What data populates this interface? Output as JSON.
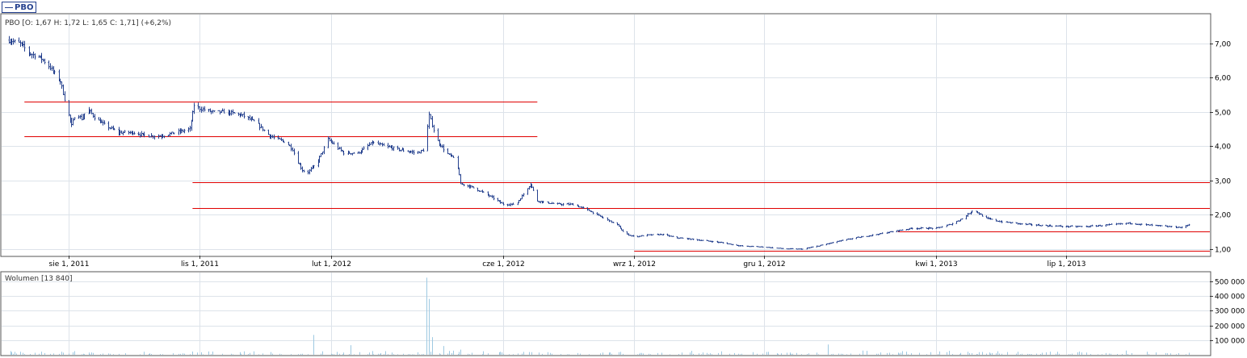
{
  "legend": {
    "label": "PBO",
    "color": "#24408e"
  },
  "price_info": "PBO [O: 1,67  H: 1,72  L: 1,65  C: 1,71] (+6,2%)",
  "volume_info": "Wolumen [13 840]",
  "colors": {
    "price": "#24408e",
    "volume": "#9ec9e2",
    "levels": "#e00000",
    "grid": "#dde3ea",
    "frame": "#555555"
  },
  "chart_data": [
    {
      "type": "line",
      "title": "PBO",
      "x_ticks": [
        "sie 1, 2011",
        "lis 1, 2011",
        "lut 1, 2012",
        "cze 1, 2012",
        "wrz 1, 2012",
        "gru 1, 2012",
        "kwi 1, 2013",
        "lip 1, 2013"
      ],
      "y_ticks": [
        "1,00",
        "2,00",
        "3,00",
        "4,00",
        "5,00",
        "6,00",
        "7,00"
      ],
      "ylim": [
        0.8,
        7.85
      ],
      "xlim": [
        "2011-06-15",
        "2013-10-10"
      ],
      "series": [
        {
          "name": "PBO",
          "x": [
            "2011-06-20",
            "2011-06-28",
            "2011-07-05",
            "2011-07-12",
            "2011-07-19",
            "2011-07-26",
            "2011-07-30",
            "2011-08-03",
            "2011-08-06",
            "2011-08-10",
            "2011-08-14",
            "2011-08-20",
            "2011-08-27",
            "2011-09-05",
            "2011-09-15",
            "2011-09-25",
            "2011-10-05",
            "2011-10-15",
            "2011-10-25",
            "2011-10-28",
            "2011-11-01",
            "2011-11-10",
            "2011-11-20",
            "2011-12-01",
            "2011-12-10",
            "2011-12-20",
            "2012-01-01",
            "2012-01-05",
            "2012-01-08",
            "2012-01-12",
            "2012-01-15",
            "2012-01-22",
            "2012-01-30",
            "2012-02-10",
            "2012-02-20",
            "2012-03-01",
            "2012-03-10",
            "2012-03-20",
            "2012-04-01",
            "2012-04-07",
            "2012-04-10",
            "2012-04-15",
            "2012-04-22",
            "2012-04-29",
            "2012-05-02",
            "2012-05-10",
            "2012-05-20",
            "2012-06-01",
            "2012-06-10",
            "2012-06-15",
            "2012-06-20",
            "2012-06-25",
            "2012-07-01",
            "2012-07-10",
            "2012-07-20",
            "2012-08-01",
            "2012-08-10",
            "2012-08-20",
            "2012-08-25",
            "2012-09-01",
            "2012-09-10",
            "2012-09-20",
            "2012-10-01",
            "2012-10-15",
            "2012-11-01",
            "2012-11-15",
            "2012-12-01",
            "2012-12-15",
            "2012-12-28",
            "2013-01-10",
            "2013-01-20",
            "2013-02-01",
            "2013-02-15",
            "2013-03-01",
            "2013-03-15",
            "2013-04-01",
            "2013-04-10",
            "2013-04-20",
            "2013-04-27",
            "2013-05-05",
            "2013-05-15",
            "2013-06-01",
            "2013-06-15",
            "2013-07-01",
            "2013-07-15",
            "2013-08-01",
            "2013-08-15",
            "2013-08-25",
            "2013-09-01",
            "2013-09-10",
            "2013-09-20",
            "2013-09-25"
          ],
          "y": [
            7.1,
            7.0,
            6.7,
            6.6,
            6.3,
            5.9,
            5.2,
            4.6,
            5.0,
            4.8,
            5.1,
            4.8,
            4.6,
            4.4,
            4.4,
            4.3,
            4.3,
            4.4,
            4.5,
            5.2,
            5.1,
            5.0,
            5.0,
            4.9,
            4.7,
            4.3,
            4.1,
            3.9,
            3.6,
            3.3,
            3.2,
            3.5,
            4.2,
            3.8,
            3.8,
            4.1,
            4.0,
            3.9,
            3.8,
            3.9,
            4.9,
            4.2,
            3.8,
            3.6,
            2.9,
            2.8,
            2.6,
            2.3,
            2.3,
            2.6,
            2.9,
            2.4,
            2.35,
            2.3,
            2.3,
            2.1,
            1.9,
            1.7,
            1.45,
            1.35,
            1.4,
            1.42,
            1.32,
            1.26,
            1.18,
            1.08,
            1.05,
            1.0,
            0.99,
            1.1,
            1.2,
            1.3,
            1.4,
            1.5,
            1.6,
            1.6,
            1.7,
            1.9,
            2.15,
            1.9,
            1.8,
            1.72,
            1.68,
            1.65,
            1.65,
            1.7,
            1.75,
            1.7,
            1.68,
            1.65,
            1.62,
            1.71
          ]
        }
      ],
      "levels": [
        {
          "y": 5.3,
          "x_start": "2011-07-01",
          "x_end": "2012-06-25"
        },
        {
          "y": 4.3,
          "x_start": "2011-07-01",
          "x_end": "2012-06-25"
        },
        {
          "y": 2.95,
          "x_start": "2011-10-27",
          "x_end": "2013-10-10"
        },
        {
          "y": 2.2,
          "x_start": "2011-10-27",
          "x_end": "2013-10-10"
        },
        {
          "y": 1.5,
          "x_start": "2013-03-05",
          "x_end": "2013-10-10"
        },
        {
          "y": 0.95,
          "x_start": "2012-09-01",
          "x_end": "2013-10-10"
        }
      ]
    },
    {
      "type": "bar",
      "title": "Wolumen",
      "y_ticks": [
        "100 000",
        "200 000",
        "300 000",
        "400 000",
        "500 000"
      ],
      "ylim": [
        0,
        560000
      ],
      "x": [
        "2011-06-25",
        "2011-08-05",
        "2011-09-10",
        "2011-10-30",
        "2011-12-15",
        "2012-01-20",
        "2012-02-05",
        "2012-02-15",
        "2012-03-10",
        "2012-04-08",
        "2012-04-10",
        "2012-04-12",
        "2012-04-20",
        "2012-05-02",
        "2012-06-15",
        "2012-08-10",
        "2012-09-20",
        "2012-11-10",
        "2012-12-10",
        "2013-01-15",
        "2013-03-20",
        "2013-05-01",
        "2013-07-10",
        "2013-09-10",
        "2013-09-25"
      ],
      "values": [
        8000,
        12000,
        10000,
        15000,
        9000,
        135000,
        20000,
        65000,
        25000,
        525000,
        380000,
        120000,
        60000,
        35000,
        20000,
        15000,
        14000,
        12000,
        10000,
        70000,
        13000,
        18000,
        22000,
        10000,
        13840
      ]
    }
  ]
}
